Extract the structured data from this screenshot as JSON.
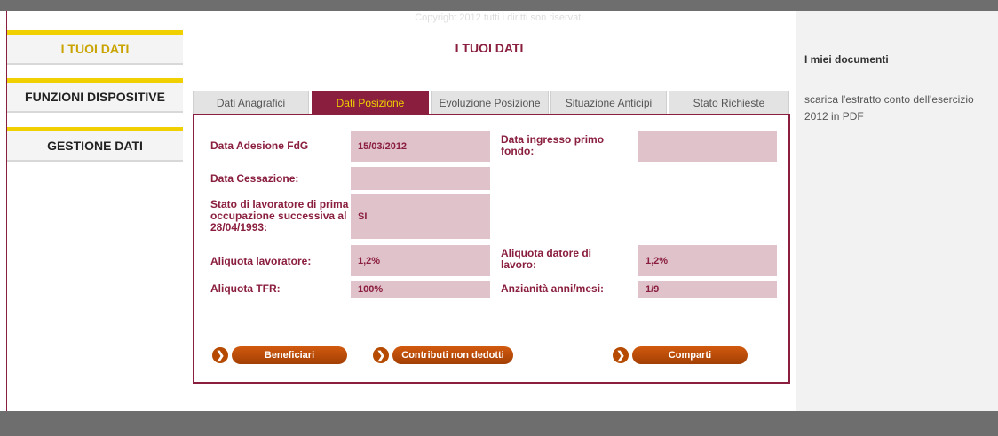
{
  "nav": {
    "items": [
      {
        "label": "I TUOI DATI"
      },
      {
        "label": "FUNZIONI DISPOSITIVE"
      },
      {
        "label": "GESTIONE DATI"
      }
    ]
  },
  "page": {
    "title": "I TUOI DATI"
  },
  "tabs": [
    {
      "label": "Dati Anagrafici"
    },
    {
      "label": "Dati Posizione"
    },
    {
      "label": "Evoluzione Posizione"
    },
    {
      "label": "Situazione Anticipi"
    },
    {
      "label": "Stato Richieste"
    }
  ],
  "fields": {
    "data_adesione": {
      "label": "Data Adesione FdG",
      "value": "15/03/2012"
    },
    "data_ingresso": {
      "label": "Data ingresso primo fondo:",
      "value": ""
    },
    "data_cessazione": {
      "label": "Data Cessazione:",
      "value": ""
    },
    "stato_lavoratore": {
      "label": "Stato di lavoratore di prima occupazione successiva al 28/04/1993:",
      "value": "SI"
    },
    "aliquota_lavoratore": {
      "label": "Aliquota lavoratore:",
      "value": "1,2%"
    },
    "aliquota_datore": {
      "label": "Aliquota datore di lavoro:",
      "value": "1,2%"
    },
    "aliquota_tfr": {
      "label": "Aliquota TFR:",
      "value": "100%"
    },
    "anzianita": {
      "label": "Anzianità anni/mesi:",
      "value": "1/9"
    }
  },
  "buttons": {
    "beneficiari": "Beneficiari",
    "contributi": "Contributi non dedotti",
    "comparti": "Comparti"
  },
  "sidebar": {
    "title": "I miei documenti",
    "link_line1": "scarica l'estratto conto dell'esercizio",
    "link_line2": "2012 in PDF"
  },
  "footer": {
    "text": "Copyright 2012 tutti i diritti son riservati"
  },
  "colors": {
    "brand": "#8a1e3e",
    "accent": "#f0d000",
    "button": "#c4510a",
    "field_bg": "#e0c2cb"
  }
}
